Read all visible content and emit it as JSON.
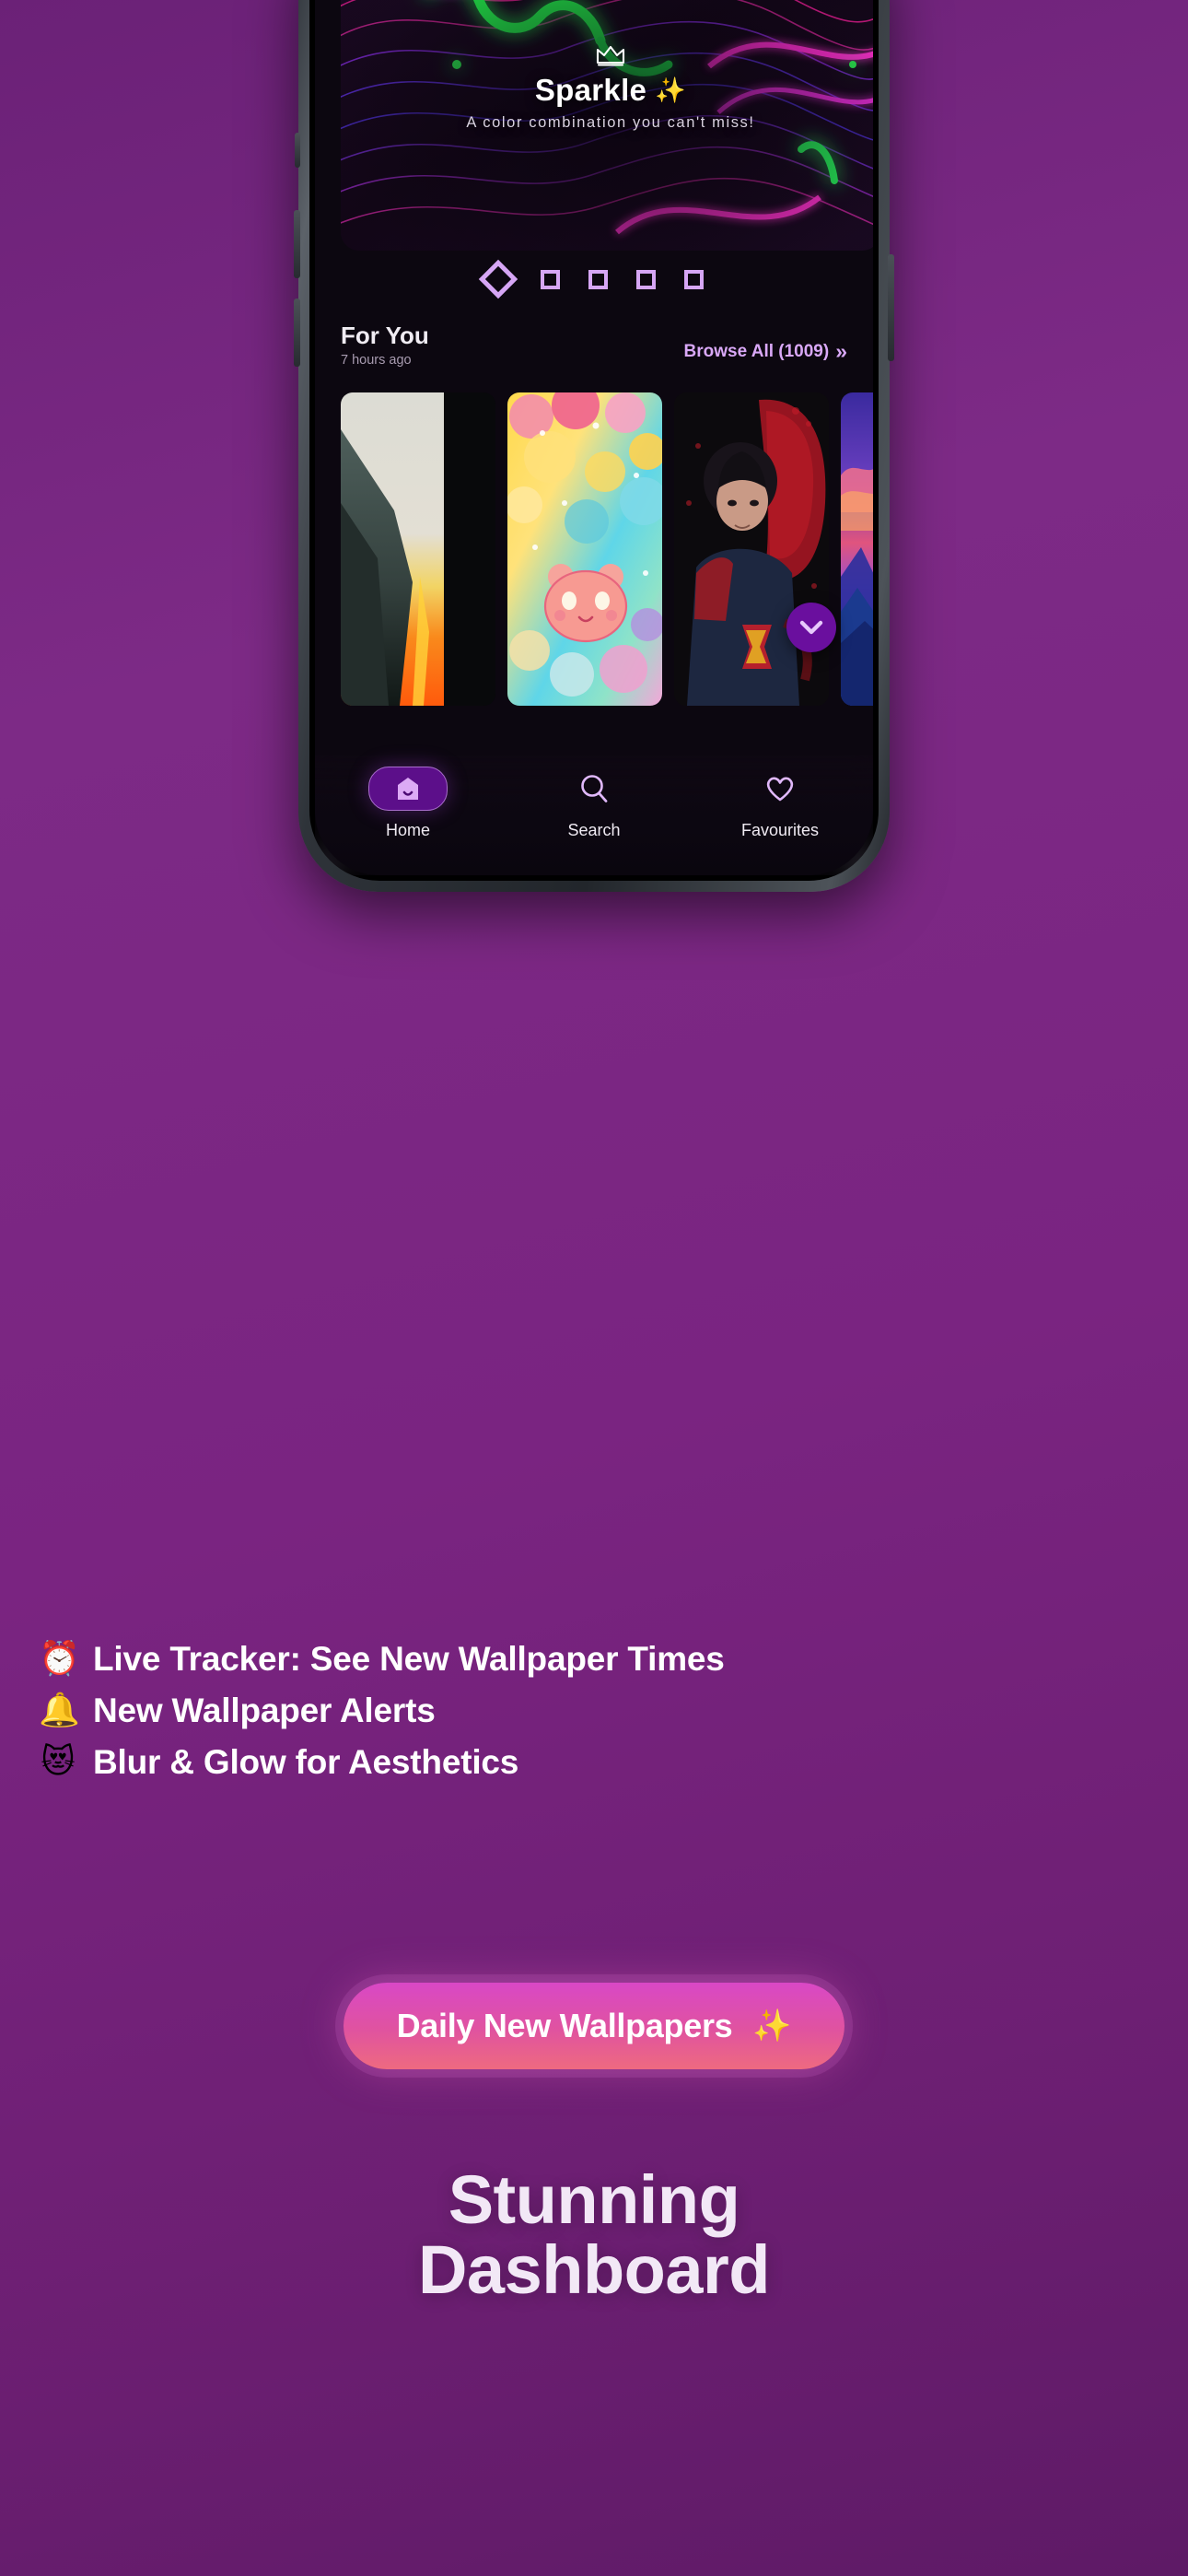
{
  "phone": {
    "hero": {
      "icon": "crown-icon",
      "title": "Sparkle",
      "title_emoji": "✨",
      "subtitle": "A color combination you can't miss!"
    },
    "carousel": {
      "total_dots": 5,
      "active_index": 0
    },
    "section": {
      "title": "For You",
      "timestamp": "7 hours ago",
      "browse_label": "Browse All (1009)",
      "browse_chevrons": "»"
    },
    "thumbnails": [
      {
        "name": "mountain-sunset-wallpaper"
      },
      {
        "name": "kawaii-pastel-bears-wallpaper"
      },
      {
        "name": "superman-dark-wallpaper"
      },
      {
        "name": "aurora-mountains-wallpaper"
      }
    ],
    "scroll_fab": {
      "icon": "chevron-down-icon"
    },
    "nav": [
      {
        "label": "Home",
        "icon": "home-icon",
        "active": true
      },
      {
        "label": "Search",
        "icon": "search-icon",
        "active": false
      },
      {
        "label": "Favourites",
        "icon": "heart-icon",
        "active": false
      }
    ]
  },
  "features": [
    {
      "emoji": "⏰",
      "emoji_name": "alarm-clock-emoji",
      "text": "Live Tracker: See New Wallpaper Times"
    },
    {
      "emoji": "🔔",
      "emoji_name": "bell-emoji",
      "text": "New Wallpaper Alerts"
    },
    {
      "emoji": "😻",
      "emoji_name": "heart-eyes-cat-emoji",
      "text": "Blur & Glow for Aesthetics"
    }
  ],
  "cta": {
    "label": "Daily New Wallpapers",
    "emoji": "✨"
  },
  "headline": {
    "line1": "Stunning",
    "line2": "Dashboard"
  },
  "colors": {
    "background_purple": "#7a2481",
    "accent_purple": "#6a0f9e",
    "light_purple": "#d6a6f5",
    "cta_pink": "#e0539f",
    "text_white": "#ffffff"
  }
}
